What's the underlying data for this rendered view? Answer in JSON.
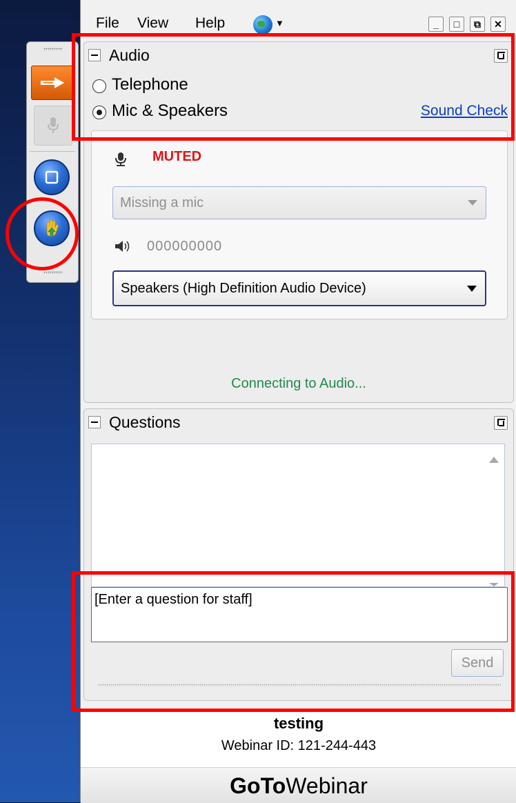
{
  "menu": {
    "file": "File",
    "view": "View",
    "help": "Help",
    "globe_icon": "globe-icon"
  },
  "window_controls": [
    "minimize",
    "maximize",
    "restore",
    "close"
  ],
  "audio": {
    "title": "Audio",
    "options": {
      "telephone": "Telephone",
      "mic_speakers": "Mic & Speakers"
    },
    "selected": "Mic & Speakers",
    "sound_check": "Sound Check",
    "mic_status": "MUTED",
    "mic_select": "Missing a mic",
    "speaker_level": "000000000",
    "speaker_select": "Speakers (High Definition Audio Device)",
    "status": "Connecting to Audio..."
  },
  "questions": {
    "title": "Questions",
    "input_placeholder": "[Enter a question for staff]",
    "send": "Send"
  },
  "footer": {
    "webinar_title": "testing",
    "webinar_id": "Webinar ID: 121-244-443",
    "brand_bold": "GoTo",
    "brand_light": "Webinar"
  },
  "colors": {
    "muted": "#e1141a",
    "status": "#1f8a4a",
    "link": "#0a3cc7",
    "highlight": "#ff0000",
    "toolbar_arrow": "#ff8a2e"
  }
}
